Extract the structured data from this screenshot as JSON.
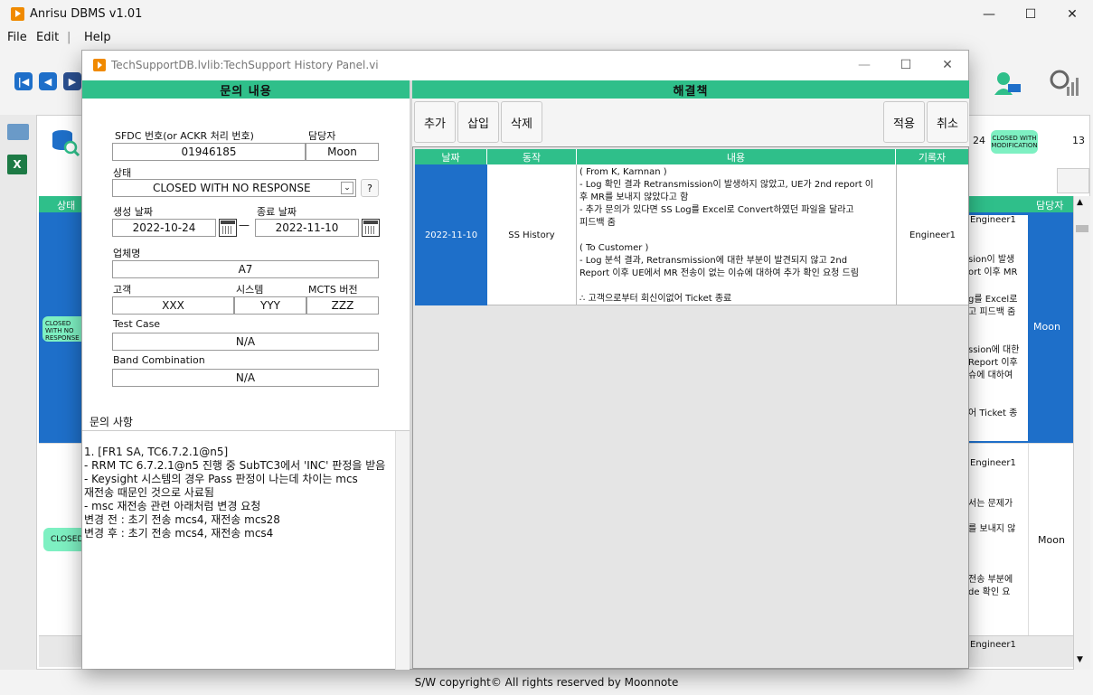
{
  "app": {
    "title": "Anrisu DBMS v1.01",
    "minimize": "—",
    "maximize": "☐",
    "close": "✕"
  },
  "menu": {
    "file": "File",
    "edit": "Edit",
    "separator": "|",
    "help": "Help"
  },
  "nav": {
    "first": "|◀",
    "prev": "◀",
    "next": "▶",
    "last": "▶|"
  },
  "background": {
    "count_left": "24",
    "badge_closed_mod": "CLOSED WITH MODIFICATION",
    "count_right": "13",
    "col_status": "상태",
    "col_owner": "담당자",
    "rows": [
      {
        "status": "CLOSED WITH NO RESPONSE",
        "engineer": "Engineer1",
        "frag1": "sion이 발생",
        "frag2": "ort 이후 MR",
        "frag3": "g를 Excel로",
        "frag4": "고 피드백 줌",
        "frag5": "ssion에 대한",
        "frag6": "Report 이후",
        "frag7": "슈에 대하여",
        "frag8": "어 Ticket 종",
        "owner": "Moon"
      },
      {
        "status": "CLOSED",
        "engineer": "Engineer1",
        "frag1": "서는 문제가",
        "frag2": "를 보내지 않",
        "frag3": "전송 부분에",
        "frag4": "de 확인 요",
        "owner": "Moon"
      },
      {
        "engineer": "Engineer1"
      }
    ]
  },
  "child": {
    "title": "TechSupportDB.lvlib:TechSupport History Panel.vi",
    "left_header": "문의 내용",
    "right_header": "해결책",
    "form": {
      "sfdc_label": "SFDC 번호(or ACKR 처리 번호)",
      "owner_label": "담당자",
      "sfdc_value": "01946185",
      "owner_value": "Moon",
      "status_label": "상태",
      "status_value": "CLOSED WITH NO RESPONSE",
      "help_button": "?",
      "created_label": "생성 날짜",
      "closed_label": "종료 날짜",
      "created_value": "2022-10-24",
      "date_sep": "—",
      "closed_value": "2022-11-10",
      "company_label": "업체명",
      "company_value": "A7",
      "customer_label": "고객",
      "system_label": "시스템",
      "mcts_label": "MCTS 버전",
      "customer_value": "XXX",
      "system_value": "YYY",
      "mcts_value": "ZZZ",
      "testcase_label": "Test Case",
      "testcase_value": "N/A",
      "band_label": "Band Combination",
      "band_value": "N/A",
      "inquiry_label": "문의 사항",
      "inquiry_text": "1. [FR1 SA, TC6.7.2.1@n5]\n- RRM TC 6.7.2.1@n5 진행 중 SubTC3에서 'INC' 판정을 받음\n- Keysight 시스템의 경우 Pass 판정이 나는데 차이는 mcs\n재전송 때문인 것으로 사료됨\n- msc 재전송 관련 아래처럼 변경 요청\n변경 전 : 초기 전송 mcs4, 재전송 mcs28\n변경 후 : 초기 전송 mcs4, 재전송 mcs4"
    },
    "buttons": {
      "add": "추가",
      "insert": "삽입",
      "delete": "삭제",
      "apply": "적용",
      "cancel": "취소"
    },
    "history": {
      "columns": [
        "날짜",
        "동작",
        "내용",
        "기록자"
      ],
      "rows": [
        {
          "date": "2022-11-10",
          "action": "SS History",
          "content": "( From K, Karnnan )\n- Log 확인 결과 Retransmission이 발생하지 않았고, UE가 2nd report 이\n후 MR를 보내지 않았다고 함\n- 추가 문의가 있다면 SS Log를 Excel로 Convert하였던 파일을 달라고\n피드백 줌\n\n( To Customer )\n- Log 분석 결과, Retransmission에 대한 부분이 발견되지 않고 2nd\nReport 이후 UE에서 MR 전송이 없는 이슈에 대하여 추가 확인 요청 드림\n\n∴ 고객으로부터 회신이없어 Ticket 종료",
          "recorder": "Engineer1"
        }
      ]
    }
  },
  "footer": "S/W copyright© All rights reserved by Moonnote",
  "colors": {
    "accent_green": "#2fbf8a",
    "selection_blue": "#1e6fc9",
    "logo_orange": "#f08a00"
  }
}
